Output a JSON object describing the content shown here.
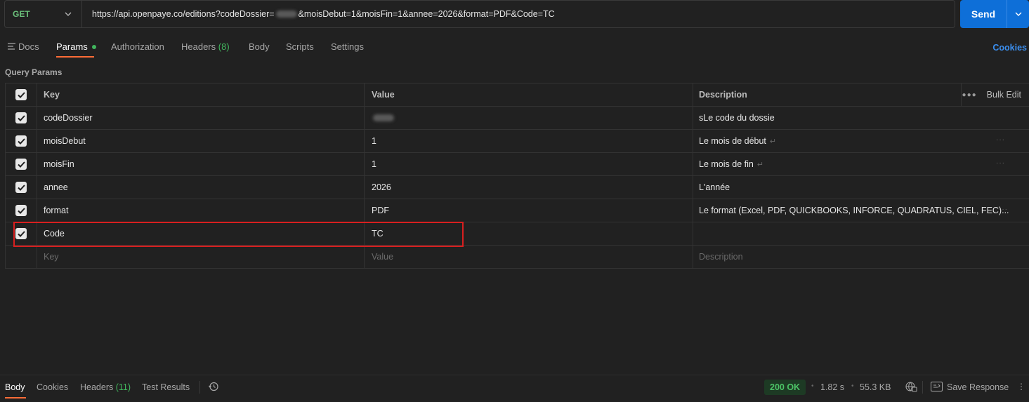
{
  "request": {
    "method": "GET",
    "url_before": "https://api.openpaye.co/editions?codeDossier=",
    "url_after": "&moisDebut=1&moisFin=1&annee=2026&format=PDF&Code=TC",
    "send_label": "Send"
  },
  "tabs": {
    "docs": "Docs",
    "params": "Params",
    "authorization": "Authorization",
    "headers": "Headers",
    "headers_count": "(8)",
    "body": "Body",
    "scripts": "Scripts",
    "settings": "Settings",
    "cookies": "Cookies"
  },
  "params": {
    "section_title": "Query Params",
    "columns": {
      "key": "Key",
      "value": "Value",
      "description": "Description",
      "bulk_edit": "Bulk Edit"
    },
    "rows": [
      {
        "key": "codeDossier",
        "value": "",
        "description": "sLe code du dossie",
        "value_redacted": true
      },
      {
        "key": "moisDebut",
        "value": "1",
        "description": "Le mois de début"
      },
      {
        "key": "moisFin",
        "value": "1",
        "description": "Le mois de fin"
      },
      {
        "key": "annee",
        "value": "2026",
        "description": "L'année"
      },
      {
        "key": "format",
        "value": "PDF",
        "description": "Le format (Excel, PDF, QUICKBOOKS, INFORCE, QUADRATUS, CIEL, FEC)..."
      },
      {
        "key": "Code",
        "value": "TC",
        "description": ""
      }
    ],
    "placeholders": {
      "key": "Key",
      "value": "Value",
      "description": "Description"
    }
  },
  "response": {
    "tabs": {
      "body": "Body",
      "cookies": "Cookies",
      "headers": "Headers",
      "headers_count": "(11)",
      "test_results": "Test Results"
    },
    "status": "200 OK",
    "time": "1.82 s",
    "size": "55.3 KB",
    "save_label": "Save Response"
  },
  "colors": {
    "accent": "#ff6c37",
    "send": "#0e6fd8",
    "success": "#41b65d",
    "highlight": "#d81f1f"
  }
}
